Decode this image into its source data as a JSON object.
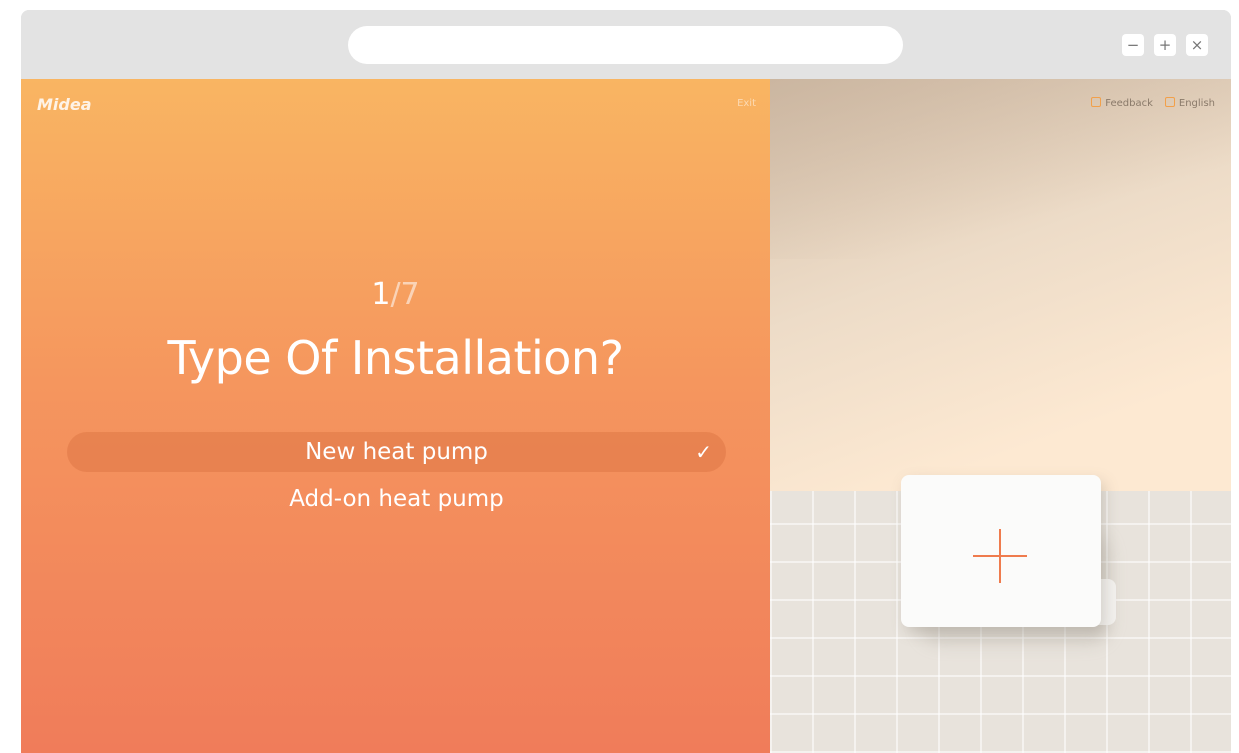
{
  "app": {
    "logo_text": "Midea",
    "exit_label": "Exit"
  },
  "window_controls": {
    "minimize": "−",
    "maximize": "+",
    "close": "×"
  },
  "quiz": {
    "step_current": "1",
    "step_total": "/7",
    "question": "Type Of Installation?",
    "options": [
      {
        "label": "New heat pump",
        "selected": true
      },
      {
        "label": "Add-on heat pump",
        "selected": false
      }
    ],
    "check_glyph": "✓"
  },
  "topnav": {
    "feedback": "Feedback",
    "language": "English"
  },
  "colors": {
    "gradient_top": "#f9b562",
    "gradient_bottom": "#f07c5a",
    "accent": "#ef7b4d"
  },
  "icons": [
    "check-icon",
    "plus-icon",
    "feedback-icon",
    "language-icon"
  ]
}
